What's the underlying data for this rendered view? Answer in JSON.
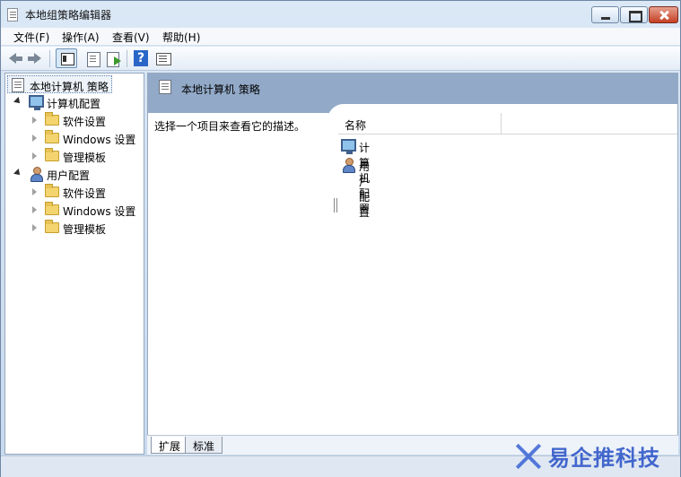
{
  "window": {
    "title": "本地组策略编辑器"
  },
  "menu": [
    "文件(F)",
    "操作(A)",
    "查看(V)",
    "帮助(H)"
  ],
  "toolbar": {
    "icons": [
      "back-icon",
      "forward-icon",
      "show-tree-icon",
      "properties-icon",
      "export-icon",
      "help-icon",
      "view-icon"
    ]
  },
  "tree": {
    "root": "本地计算机 策略",
    "computer": {
      "label": "计算机配置",
      "children": [
        "软件设置",
        "Windows 设置",
        "管理模板"
      ]
    },
    "user": {
      "label": "用户配置",
      "children": [
        "软件设置",
        "Windows 设置",
        "管理模板"
      ]
    }
  },
  "content": {
    "title": "本地计算机 策略",
    "description": "选择一个项目来查看它的描述。",
    "column": "名称",
    "items": [
      "计算机配置",
      "用户配置"
    ]
  },
  "tabs": [
    "扩展",
    "标准"
  ],
  "watermark": {
    "text": "易企推科技"
  }
}
